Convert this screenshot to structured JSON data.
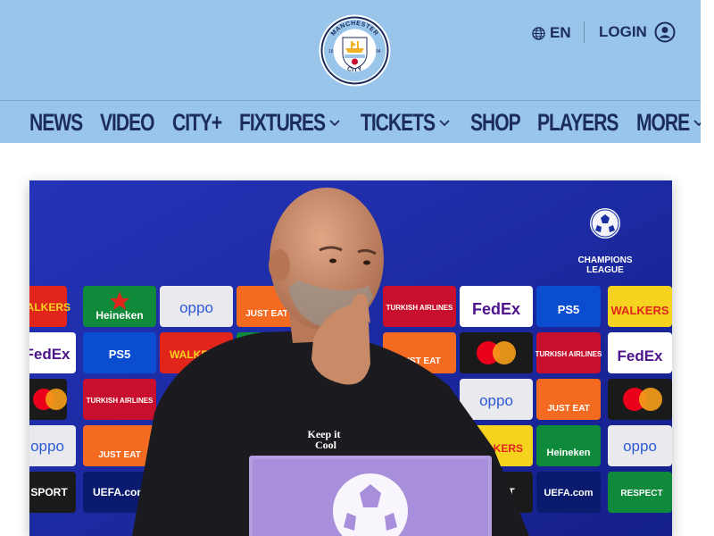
{
  "header": {
    "crest_text_top": "MANCHESTER",
    "crest_text_bottom": "CITY",
    "crest_year_left": "18",
    "crest_year_right": "94",
    "language_label": "EN",
    "login_label": "LOGIN"
  },
  "nav": {
    "items": [
      {
        "label": "NEWS",
        "has_dropdown": false
      },
      {
        "label": "VIDEO",
        "has_dropdown": false
      },
      {
        "label": "CITY+",
        "has_dropdown": false
      },
      {
        "label": "FIXTURES",
        "has_dropdown": true
      },
      {
        "label": "TICKETS",
        "has_dropdown": true
      },
      {
        "label": "SHOP",
        "has_dropdown": false
      },
      {
        "label": "PLAYERS",
        "has_dropdown": false
      },
      {
        "label": "MORE",
        "has_dropdown": true
      }
    ]
  },
  "hero": {
    "shirt_text_1": "Keep it",
    "shirt_text_2": "Cool",
    "league_label_1": "CHAMPIONS",
    "league_label_2": "LEAGUE",
    "sponsors": {
      "walkers": "WALKERS",
      "heineken": "Heineken",
      "oppo": "oppo",
      "justeat": "JUST EAT",
      "turkish": "TURKISH AIRLINES",
      "fedex": "FedEx",
      "ps5": "PS5",
      "uefa": "UEFA.com",
      "sport": "SPORT",
      "respect": "RESPECT"
    }
  },
  "colors": {
    "sky_blue": "#99c5ea",
    "navy": "#1c2c5b",
    "backdrop_blue": "#1a2fa0"
  }
}
